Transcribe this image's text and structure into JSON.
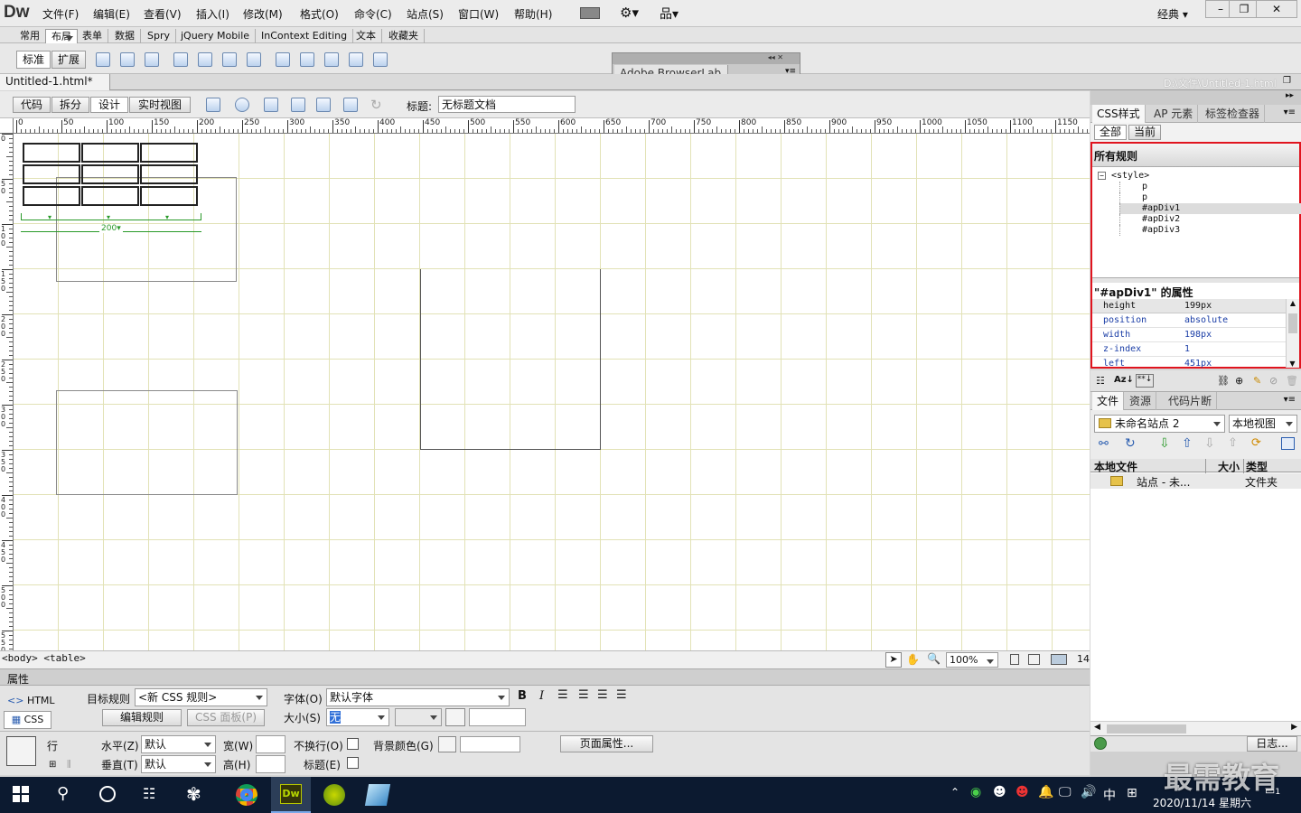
{
  "app": {
    "logo": "Dw"
  },
  "menu": {
    "items": [
      "文件(F)",
      "编辑(E)",
      "查看(V)",
      "插入(I)",
      "修改(M)",
      "格式(O)",
      "命令(C)",
      "站点(S)",
      "窗口(W)",
      "帮助(H)"
    ],
    "workspace": "经典",
    "window_controls": [
      "–",
      "❐",
      "✕"
    ]
  },
  "insert_tabs": {
    "items": [
      "常用",
      "布局",
      "表单",
      "数据",
      "Spry",
      "jQuery Mobile",
      "InContext Editing",
      "文本",
      "收藏夹"
    ],
    "selected": "布局"
  },
  "insert_bar": {
    "mode_buttons": [
      "标准",
      "扩展"
    ]
  },
  "browserlab": {
    "title": "Adobe BrowserLab"
  },
  "document": {
    "tab_name": "Untitled-1.html*",
    "tab_close": "×",
    "path": "D:\\文件\\Untitled-1.html",
    "view_buttons": [
      "代码",
      "拆分",
      "设计",
      "实时视图"
    ],
    "title_label": "标题:",
    "title_value": "无标题文档"
  },
  "ruler": {
    "h_labels": [
      "0",
      "50",
      "100",
      "150",
      "200",
      "250",
      "300",
      "350",
      "400",
      "450",
      "500",
      "550",
      "600",
      "650",
      "700",
      "750",
      "800",
      "850",
      "900",
      "950",
      "1000",
      "1050",
      "1100",
      "1150"
    ],
    "v_labels": [
      "0",
      "50",
      "100",
      "150",
      "200",
      "250",
      "300",
      "350",
      "400",
      "450",
      "500",
      "550"
    ]
  },
  "table_widget": {
    "width_label": "200"
  },
  "status_bar": {
    "tags": "<body> <table>",
    "zoom": "100%",
    "size_hint": "14:"
  },
  "properties": {
    "title": "属性",
    "html_label": "HTML",
    "css_label": "CSS",
    "target_rule_label": "目标规则",
    "target_rule_value": "<新 CSS 规则>",
    "edit_rule": "编辑规则",
    "css_panel": "CSS 面板(P)",
    "font_label": "字体(O)",
    "font_value": "默认字体",
    "size_label": "大小(S)",
    "size_value": "无",
    "row_label": "行",
    "horz_label": "水平(Z)",
    "horz_value": "默认",
    "vert_label": "垂直(T)",
    "vert_value": "默认",
    "width_label": "宽(W)",
    "height_label": "高(H)",
    "nowrap_label": "不换行(O)",
    "header_label": "标题(E)",
    "bgcolor_label": "背景颜色(G)",
    "page_props": "页面属性..."
  },
  "css_panel": {
    "tabs": [
      "CSS样式",
      "AP 元素",
      "标签检查器"
    ],
    "mode_tabs": [
      "全部",
      "当前"
    ],
    "all_rules_title": "所有规则",
    "tree": [
      {
        "label": "<style>",
        "level": 0
      },
      {
        "label": "p",
        "level": 1
      },
      {
        "label": "p",
        "level": 1
      },
      {
        "label": "#apDiv1",
        "level": 1,
        "selected": true
      },
      {
        "label": "#apDiv2",
        "level": 1
      },
      {
        "label": "#apDiv3",
        "level": 1
      }
    ],
    "props_title": "\"#apDiv1\" 的属性",
    "props": [
      {
        "name": "height",
        "value": "199px"
      },
      {
        "name": "position",
        "value": "absolute"
      },
      {
        "name": "width",
        "value": "198px"
      },
      {
        "name": "z-index",
        "value": "1"
      },
      {
        "name": "left",
        "value": "451px"
      }
    ],
    "highlight_color": "#e0141e"
  },
  "files_panel": {
    "tabs": [
      "文件",
      "资源",
      "代码片断"
    ],
    "site": "未命名站点 2",
    "view": "本地视图",
    "columns": [
      "本地文件",
      "大小",
      "类型"
    ],
    "rows": [
      {
        "name": "站点 - 未...",
        "size": "",
        "type": "文件夹"
      }
    ],
    "log_button": "日志..."
  },
  "taskbar": {
    "date": "2020/11/14 星期六",
    "ime": "中",
    "watermark": "最需教育",
    "notif_count": "1"
  }
}
